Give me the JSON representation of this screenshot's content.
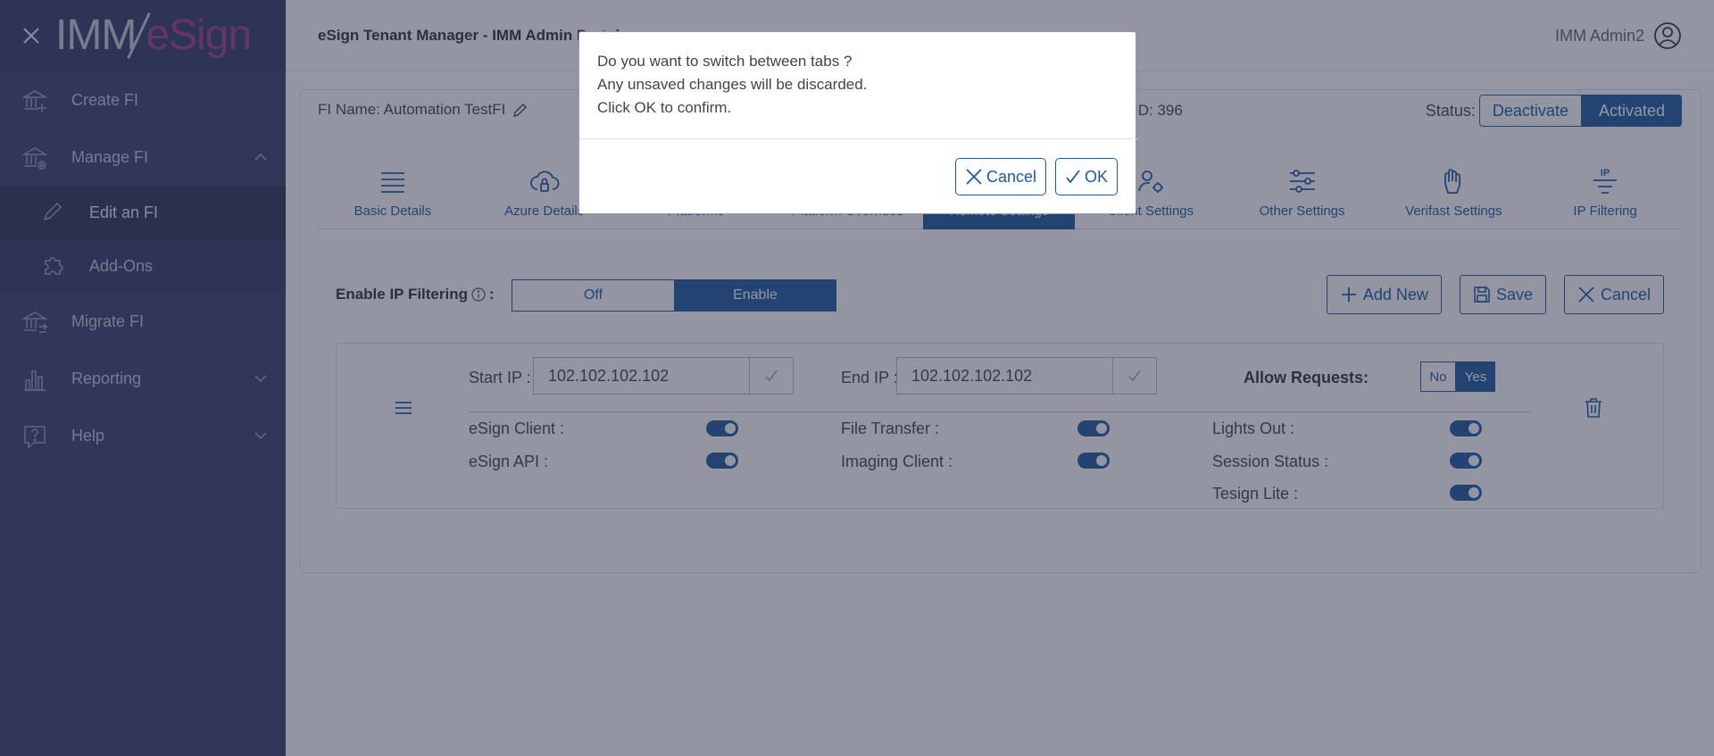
{
  "app": {
    "logo_left": "IMM",
    "logo_right": "eSign",
    "title": "eSign Tenant Manager - IMM Admin Portal",
    "user": "IMM Admin2"
  },
  "sidebar": {
    "items": [
      {
        "label": "Create FI",
        "icon": "bank-plus-icon"
      },
      {
        "label": "Manage FI",
        "icon": "bank-gear-icon"
      },
      {
        "label": "Edit an FI",
        "icon": "pencil-icon"
      },
      {
        "label": "Add-Ons",
        "icon": "puzzle-icon"
      },
      {
        "label": "Migrate FI",
        "icon": "bank-arrows-icon"
      },
      {
        "label": "Reporting",
        "icon": "bar-chart-icon"
      },
      {
        "label": "Help",
        "icon": "help-icon"
      }
    ]
  },
  "fi": {
    "name": "FI Name: Automation TestFI",
    "id": "ID: 396",
    "status_label": "Status:",
    "deactivate": "Deactivate",
    "activated": "Activated"
  },
  "tabs": [
    {
      "label": "Basic Details",
      "icon": "list-icon"
    },
    {
      "label": "Azure Details",
      "icon": "cloud-lock-icon"
    },
    {
      "label": "Platforms",
      "icon": "platforms-icon"
    },
    {
      "label": "Platform Overrides",
      "icon": "overrides-icon"
    },
    {
      "label": "Remote Settings",
      "icon": "remote-icon"
    },
    {
      "label": "Client Settings",
      "icon": "user-gear-icon"
    },
    {
      "label": "Other Settings",
      "icon": "sliders-icon"
    },
    {
      "label": "Verifast Settings",
      "icon": "hand-icon"
    },
    {
      "label": "IP Filtering",
      "icon": "ip-icon"
    }
  ],
  "ip_filtering": {
    "label": "Enable IP Filtering",
    "colon": ":",
    "off": "Off",
    "enable": "Enable",
    "add_new": "Add New",
    "save": "Save",
    "cancel": "Cancel"
  },
  "rule": {
    "start_label": "Start IP :",
    "start_value": "102.102.102.102",
    "end_label": "End IP :",
    "end_value": "102.102.102.102",
    "allow_label": "Allow Requests:",
    "no": "No",
    "yes": "Yes",
    "perms": [
      {
        "label": "eSign Client :",
        "enabled": true
      },
      {
        "label": "eSign API :",
        "enabled": true
      },
      {
        "label": "File Transfer :",
        "enabled": true
      },
      {
        "label": "Imaging Client :",
        "enabled": true
      },
      {
        "label": "Lights Out :",
        "enabled": true
      },
      {
        "label": "Session Status :",
        "enabled": true
      },
      {
        "label": "Tesign Lite :",
        "enabled": true
      }
    ]
  },
  "modal": {
    "line1": "Do you want to switch between tabs ?",
    "line2": "Any unsaved changes will be discarded.",
    "line3": "Click OK to confirm.",
    "cancel": "Cancel",
    "ok": "OK"
  },
  "colors": {
    "sidebar": "#39406a",
    "accent": "#1e5aa0",
    "logo_accent": "#a03d8b"
  }
}
